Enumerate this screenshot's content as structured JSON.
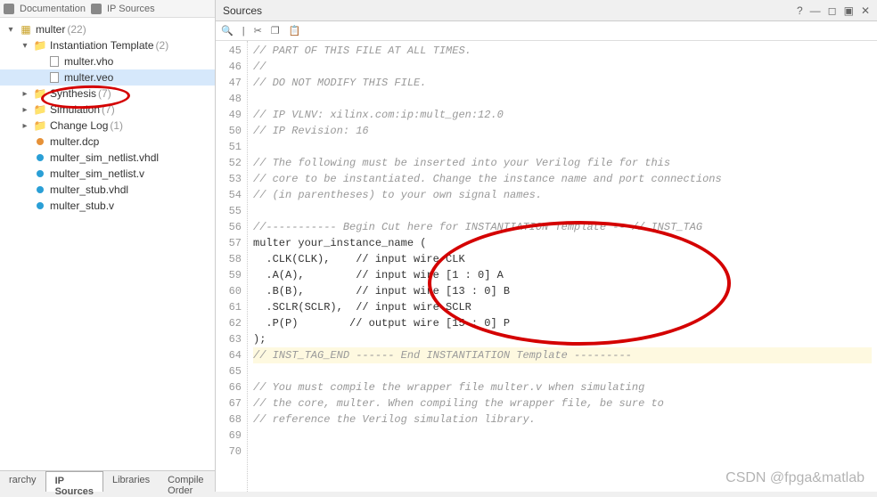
{
  "toolbar": {
    "doc_label": "Documentation",
    "ip_label": "IP Sources"
  },
  "tree": {
    "root": {
      "label": "multer",
      "count": "(22)"
    },
    "instantiation": {
      "label": "Instantiation Template",
      "count": "(2)"
    },
    "vho": "multer.vho",
    "veo": "multer.veo",
    "synthesis": {
      "label": "Synthesis",
      "count": "(7)"
    },
    "simulation": {
      "label": "Simulation",
      "count": "(7)"
    },
    "changelog": {
      "label": "Change Log",
      "count": "(1)"
    },
    "dcp": "multer.dcp",
    "sim_vhdl": "multer_sim_netlist.vhdl",
    "sim_v": "multer_sim_netlist.v",
    "stub_vhdl": "multer_stub.vhdl",
    "stub_v": "multer_stub.v"
  },
  "bottom_tabs": {
    "hierarchy": "rarchy",
    "ip_sources": "IP Sources",
    "libraries": "Libraries",
    "compile_order": "Compile Order"
  },
  "editor": {
    "title": "Sources",
    "lines": [
      {
        "n": "45",
        "t": "// PART OF THIS FILE AT ALL TIMES.",
        "c": true
      },
      {
        "n": "46",
        "t": "//",
        "c": true
      },
      {
        "n": "47",
        "t": "// DO NOT MODIFY THIS FILE.",
        "c": true
      },
      {
        "n": "48",
        "t": "",
        "c": false
      },
      {
        "n": "49",
        "t": "// IP VLNV: xilinx.com:ip:mult_gen:12.0",
        "c": true
      },
      {
        "n": "50",
        "t": "// IP Revision: 16",
        "c": true
      },
      {
        "n": "51",
        "t": "",
        "c": false
      },
      {
        "n": "52",
        "t": "// The following must be inserted into your Verilog file for this",
        "c": true
      },
      {
        "n": "53",
        "t": "// core to be instantiated. Change the instance name and port connections",
        "c": true
      },
      {
        "n": "54",
        "t": "// (in parentheses) to your own signal names.",
        "c": true
      },
      {
        "n": "55",
        "t": "",
        "c": false
      },
      {
        "n": "56",
        "t": "//----------- Begin Cut here for INSTANTIATION Template ---// INST_TAG",
        "c": true
      },
      {
        "n": "57",
        "t": "multer your_instance_name (",
        "c": false
      },
      {
        "n": "58",
        "t": "  .CLK(CLK),    // input wire CLK",
        "c": false
      },
      {
        "n": "59",
        "t": "  .A(A),        // input wire [1 : 0] A",
        "c": false
      },
      {
        "n": "60",
        "t": "  .B(B),        // input wire [13 : 0] B",
        "c": false
      },
      {
        "n": "61",
        "t": "  .SCLR(SCLR),  // input wire SCLR",
        "c": false
      },
      {
        "n": "62",
        "t": "  .P(P)        // output wire [15 : 0] P",
        "c": false
      },
      {
        "n": "63",
        "t": ");",
        "c": false
      },
      {
        "n": "64",
        "t": "// INST_TAG_END ------ End INSTANTIATION Template ---------",
        "c": true,
        "hl": true
      },
      {
        "n": "65",
        "t": "",
        "c": false
      },
      {
        "n": "66",
        "t": "// You must compile the wrapper file multer.v when simulating",
        "c": true
      },
      {
        "n": "67",
        "t": "// the core, multer. When compiling the wrapper file, be sure to",
        "c": true
      },
      {
        "n": "68",
        "t": "// reference the Verilog simulation library.",
        "c": true
      },
      {
        "n": "69",
        "t": "",
        "c": false
      },
      {
        "n": "70",
        "t": "",
        "c": false
      }
    ]
  },
  "watermark": "CSDN @fpga&matlab"
}
